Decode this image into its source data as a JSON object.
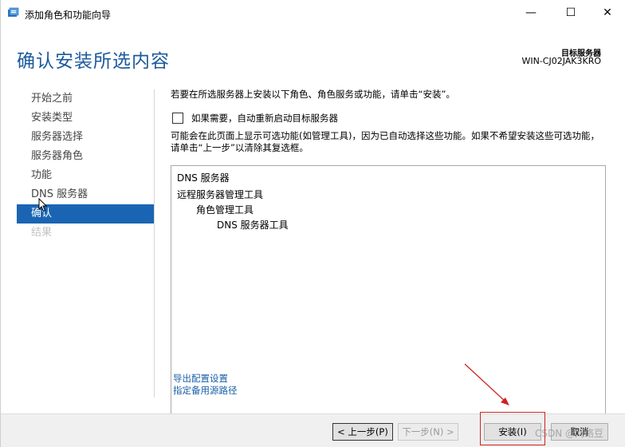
{
  "window": {
    "title": "添加角色和功能向导",
    "controls": {
      "minimize": "—",
      "maximize": "☐",
      "close": "✕"
    }
  },
  "header": {
    "title": "确认安装所选内容",
    "target_label": "目标服务器",
    "target_value": "WIN-CJ02JAK3KRO"
  },
  "nav": {
    "items": [
      {
        "label": "开始之前",
        "state": "normal"
      },
      {
        "label": "安装类型",
        "state": "normal"
      },
      {
        "label": "服务器选择",
        "state": "normal"
      },
      {
        "label": "服务器角色",
        "state": "normal"
      },
      {
        "label": "功能",
        "state": "normal"
      },
      {
        "label": "DNS 服务器",
        "state": "normal"
      },
      {
        "label": "确认",
        "state": "active"
      },
      {
        "label": "结果",
        "state": "disabled"
      }
    ]
  },
  "content": {
    "instruction": "若要在所选服务器上安装以下角色、角色服务或功能，请单击“安装”。",
    "restart_checkbox": {
      "label": "如果需要，自动重新启动目标服务器",
      "checked": false
    },
    "note": "可能会在此页面上显示可选功能(如管理工具)，因为已自动选择这些功能。如果不希望安装这些可选功能，请单击“上一步”以清除其复选框。",
    "features": [
      {
        "label": "DNS 服务器",
        "level": 0
      },
      {
        "label": "远程服务器管理工具",
        "level": 0
      },
      {
        "label": "角色管理工具",
        "level": 1
      },
      {
        "label": "DNS 服务器工具",
        "level": 2
      }
    ],
    "links": {
      "export": "导出配置设置",
      "alternate_source": "指定备用源路径"
    }
  },
  "footer": {
    "prev": "< 上一步(P)",
    "next": "下一步(N) >",
    "install": "安装(I)",
    "cancel": "取消"
  },
  "watermark": "CSDN @网络豆",
  "colors": {
    "title_blue": "#1c5a9c",
    "nav_active": "#1a65b3",
    "link_blue": "#1a5fa8",
    "annotation_red": "#d02020"
  }
}
